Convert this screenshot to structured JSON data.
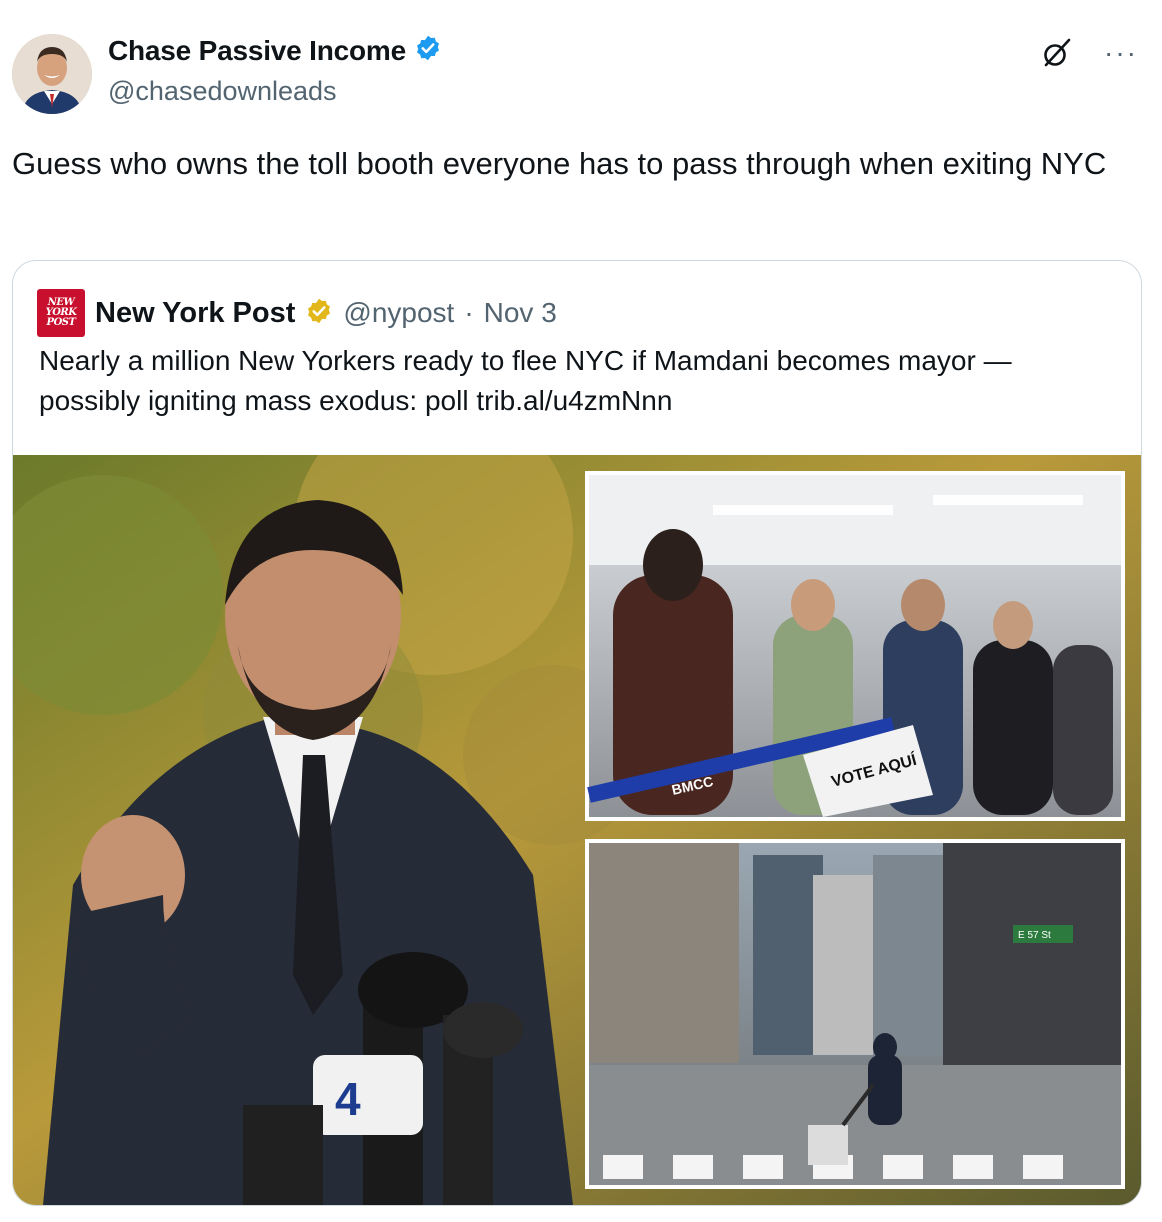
{
  "author": {
    "display_name": "Chase Passive Income",
    "handle": "@chasedownleads",
    "verified_badge_color": "#1d9bf0",
    "avatar_icon": "person-avatar"
  },
  "header_icons": [
    "grok-icon",
    "more-icon"
  ],
  "more_label": "···",
  "tweet_text": "Guess who owns the toll booth everyone has to pass through when exiting NYC",
  "quote": {
    "logo_lines": [
      "NEW",
      "YORK",
      "POST"
    ],
    "display_name": "New York Post",
    "verified_badge_color": "#e2b719",
    "handle": "@nypost",
    "separator": "·",
    "date": "Nov 3",
    "text": "Nearly a million New Yorkers ready to flee NYC if Mamdani becomes mayor — possibly igniting mass exodus: poll trib.al/u4zmNnn",
    "media": {
      "main_photo": "man-speaking-at-microphones-photo",
      "inset_top_photo": "voters-waiting-in-line-photo",
      "inset_bottom_photo": "empty-city-avenue-photo",
      "sign_text": "VOTE AQUÍ",
      "mic_flag": "4",
      "banner_text": "BMCC",
      "street_sign": "E 57 St"
    }
  },
  "colors": {
    "text_primary": "#0f1419",
    "text_secondary": "#536471",
    "border": "#cfd9de",
    "nyp_red": "#c8102e"
  }
}
